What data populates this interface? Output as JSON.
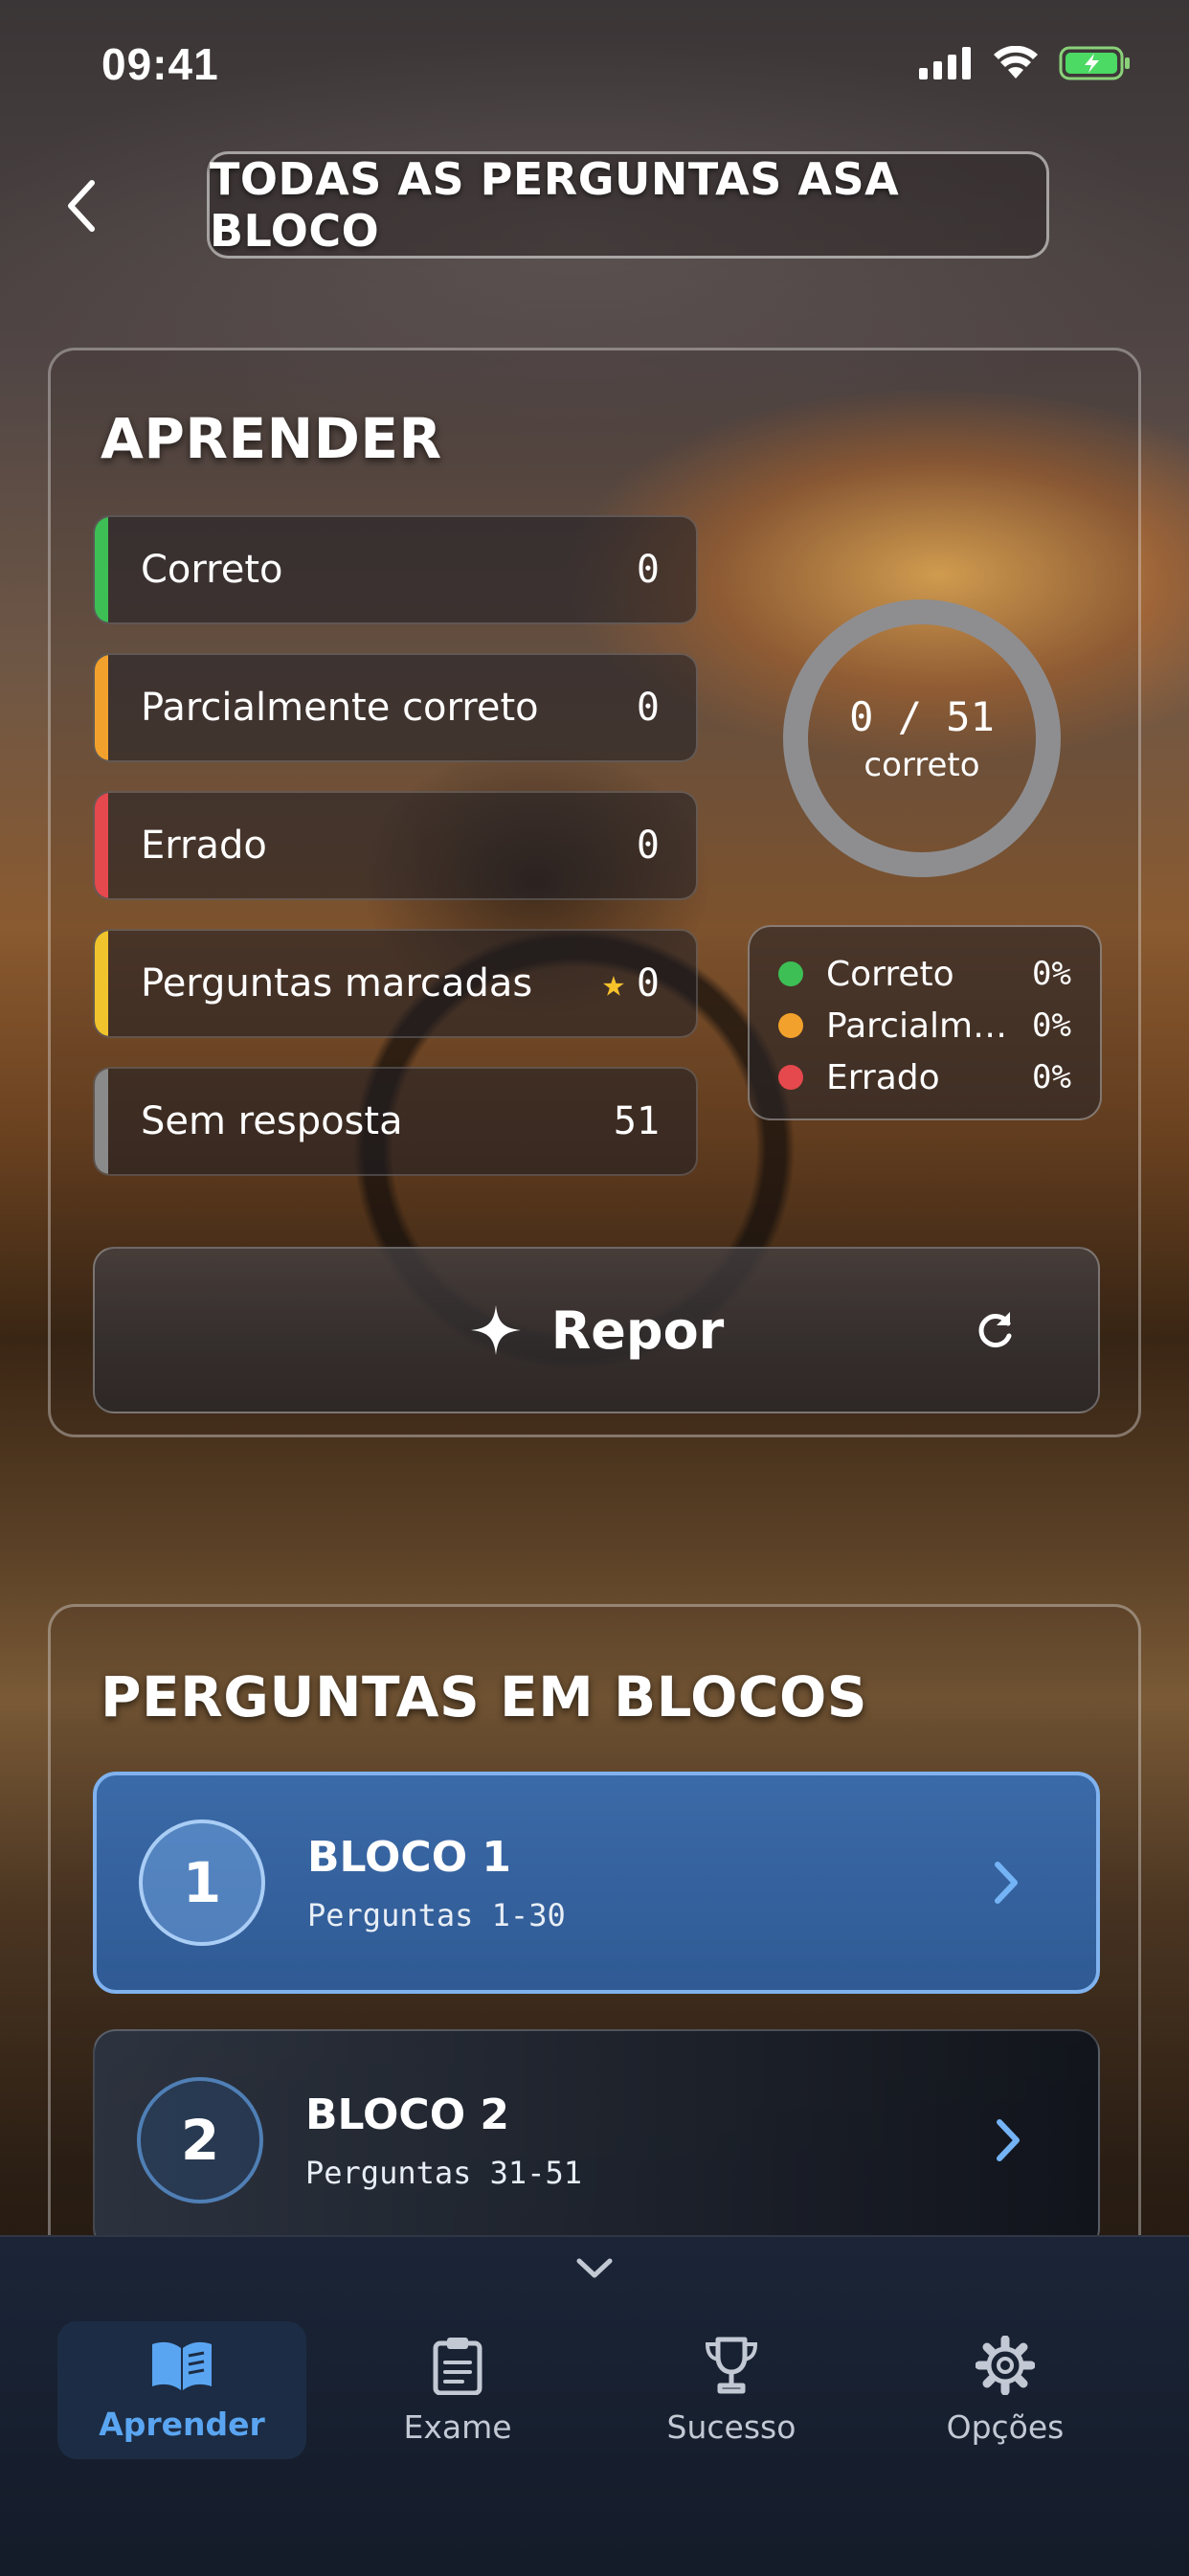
{
  "status_bar": {
    "time": "09:41"
  },
  "header": {
    "title": "TODAS AS PERGUNTAS ASA BLOCO"
  },
  "learn": {
    "title": "APRENDER",
    "stats": [
      {
        "label": "Correto",
        "value": "0",
        "color": "#3dbf55"
      },
      {
        "label": "Parcialmente correto",
        "value": "0",
        "color": "#f2a22c"
      },
      {
        "label": "Errado",
        "value": "0",
        "color": "#e5484d"
      },
      {
        "label": "Perguntas marcadas",
        "value": "0",
        "color": "#f0c42c",
        "icon": "star-icon"
      },
      {
        "label": "Sem resposta",
        "value": "51",
        "color": "#8a8a8a"
      }
    ],
    "progress": {
      "count": "0 / 51",
      "label": "correto",
      "fraction": 0
    },
    "legend": [
      {
        "label": "Correto",
        "pct": "0%",
        "color": "#3dbf55"
      },
      {
        "label": "Parcialmente correto",
        "pct": "0%",
        "color": "#f2a22c"
      },
      {
        "label": "Errado",
        "pct": "0%",
        "color": "#e5484d"
      }
    ],
    "reset_label": "Repor"
  },
  "blocks": {
    "title": "PERGUNTAS EM BLOCOS",
    "items": [
      {
        "number": "1",
        "title": "BLOCO 1",
        "subtitle": "Perguntas 1-30",
        "active": true
      },
      {
        "number": "2",
        "title": "BLOCO 2",
        "subtitle": "Perguntas 31-51",
        "active": false
      }
    ]
  },
  "tabbar": {
    "items": [
      {
        "label": "Aprender",
        "icon": "book-icon",
        "active": true
      },
      {
        "label": "Exame",
        "icon": "clipboard-icon",
        "active": false
      },
      {
        "label": "Sucesso",
        "icon": "trophy-icon",
        "active": false
      },
      {
        "label": "Opções",
        "icon": "gear-icon",
        "active": false
      }
    ]
  },
  "colors": {
    "accent": "#5aa5f1",
    "active_block": "#3b6aa8"
  }
}
